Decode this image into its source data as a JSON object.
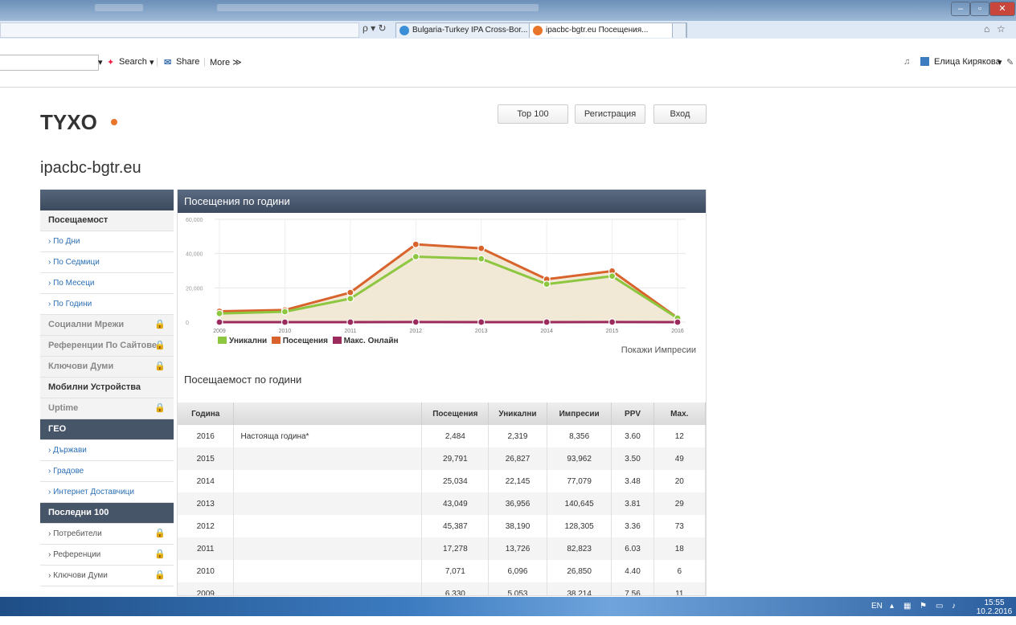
{
  "browser": {
    "tabs": [
      {
        "label": "Bulgaria-Turkey IPA Cross-Bor...",
        "icon": "ie-page-icon",
        "color": "#3b8fd8"
      },
      {
        "label": "ipacbc-bgtr.eu Посещения...",
        "icon": "tyxo-icon",
        "color": "#e8752a"
      }
    ],
    "close_tab": "×",
    "nav_glyphs": "ρ ▾ ↻",
    "search_label": "Search",
    "share_label": "Share",
    "more_label": "More ≫",
    "user_name": "Елица Кирякова"
  },
  "header": {
    "logo_text": "TYXO",
    "buttons": {
      "top100": "Top 100",
      "register": "Регистрация",
      "login": "Вход"
    },
    "site_title": "ipacbc-bgtr.eu"
  },
  "sidebar": {
    "items": [
      {
        "label": "Посещаемост",
        "type": "section"
      },
      {
        "label": "По Дни",
        "type": "link"
      },
      {
        "label": "По Седмици",
        "type": "link"
      },
      {
        "label": "По Месеци",
        "type": "link"
      },
      {
        "label": "По Години",
        "type": "link"
      },
      {
        "label": "Социални Мрежи",
        "type": "section-locked"
      },
      {
        "label": "Референции По Сайтове",
        "type": "section-locked"
      },
      {
        "label": "Ключови Думи",
        "type": "section-locked"
      },
      {
        "label": "Мобилни Устройства",
        "type": "section"
      },
      {
        "label": "Uptime",
        "type": "section-locked"
      },
      {
        "label": "ГЕО",
        "type": "dark"
      },
      {
        "label": "Държави",
        "type": "link"
      },
      {
        "label": "Градове",
        "type": "link"
      },
      {
        "label": "Интернет Доставчици",
        "type": "link"
      },
      {
        "label": "Последни 100",
        "type": "dark"
      },
      {
        "label": "Потребители",
        "type": "link-locked"
      },
      {
        "label": "Референции",
        "type": "link-locked"
      },
      {
        "label": "Ключови Думи",
        "type": "link-locked"
      }
    ]
  },
  "panel": {
    "title": "Посещения по години",
    "show_impressions": "Покажи Импресии",
    "table_title": "Посещаемост по години"
  },
  "chart_data": {
    "type": "area",
    "x": [
      "2009",
      "2010",
      "2011",
      "2012",
      "2013",
      "2014",
      "2015",
      "2016"
    ],
    "yticks": [
      "0",
      "20,000",
      "40,000",
      "60,000"
    ],
    "ylim": [
      0,
      60000
    ],
    "legend_position": "bottom-left",
    "series": [
      {
        "name": "Уникални",
        "color": "#8dc63f",
        "values": [
          5053,
          6096,
          13726,
          38190,
          36956,
          22145,
          26827,
          2319
        ]
      },
      {
        "name": "Посещения",
        "color": "#d9632c",
        "values": [
          6330,
          7071,
          17278,
          45387,
          43049,
          25034,
          29791,
          2484
        ]
      },
      {
        "name": "Макс. Онлайн",
        "color": "#9b2b5d",
        "values": [
          11,
          6,
          18,
          73,
          29,
          20,
          49,
          12
        ]
      }
    ]
  },
  "table": {
    "headers": [
      "Година",
      "",
      "Посещения",
      "Уникални",
      "Импресии",
      "PPV",
      "Max."
    ],
    "rows": [
      [
        "2016",
        "Настояща година*",
        "2,484",
        "2,319",
        "8,356",
        "3.60",
        "12"
      ],
      [
        "2015",
        "",
        "29,791",
        "26,827",
        "93,962",
        "3.50",
        "49"
      ],
      [
        "2014",
        "",
        "25,034",
        "22,145",
        "77,079",
        "3.48",
        "20"
      ],
      [
        "2013",
        "",
        "43,049",
        "36,956",
        "140,645",
        "3.81",
        "29"
      ],
      [
        "2012",
        "",
        "45,387",
        "38,190",
        "128,305",
        "3.36",
        "73"
      ],
      [
        "2011",
        "",
        "17,278",
        "13,726",
        "82,823",
        "6.03",
        "18"
      ],
      [
        "2010",
        "",
        "7,071",
        "6,096",
        "26,850",
        "4.40",
        "6"
      ],
      [
        "2009",
        "",
        "6,330",
        "5,053",
        "38,214",
        "7.56",
        "11"
      ]
    ]
  },
  "taskbar": {
    "lang": "EN",
    "time": "15:55",
    "date": "10.2.2016 г."
  }
}
